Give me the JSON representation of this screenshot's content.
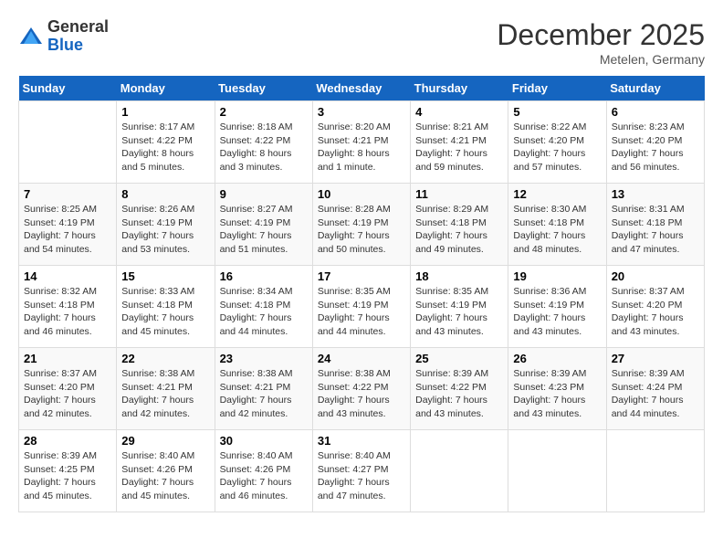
{
  "header": {
    "logo": {
      "general": "General",
      "blue": "Blue"
    },
    "title": "December 2025",
    "location": "Metelen, Germany"
  },
  "weekdays": [
    "Sunday",
    "Monday",
    "Tuesday",
    "Wednesday",
    "Thursday",
    "Friday",
    "Saturday"
  ],
  "weeks": [
    [
      {
        "day": "",
        "sunrise": "",
        "sunset": "",
        "daylight": ""
      },
      {
        "day": "1",
        "sunrise": "Sunrise: 8:17 AM",
        "sunset": "Sunset: 4:22 PM",
        "daylight": "Daylight: 8 hours and 5 minutes."
      },
      {
        "day": "2",
        "sunrise": "Sunrise: 8:18 AM",
        "sunset": "Sunset: 4:22 PM",
        "daylight": "Daylight: 8 hours and 3 minutes."
      },
      {
        "day": "3",
        "sunrise": "Sunrise: 8:20 AM",
        "sunset": "Sunset: 4:21 PM",
        "daylight": "Daylight: 8 hours and 1 minute."
      },
      {
        "day": "4",
        "sunrise": "Sunrise: 8:21 AM",
        "sunset": "Sunset: 4:21 PM",
        "daylight": "Daylight: 7 hours and 59 minutes."
      },
      {
        "day": "5",
        "sunrise": "Sunrise: 8:22 AM",
        "sunset": "Sunset: 4:20 PM",
        "daylight": "Daylight: 7 hours and 57 minutes."
      },
      {
        "day": "6",
        "sunrise": "Sunrise: 8:23 AM",
        "sunset": "Sunset: 4:20 PM",
        "daylight": "Daylight: 7 hours and 56 minutes."
      }
    ],
    [
      {
        "day": "7",
        "sunrise": "Sunrise: 8:25 AM",
        "sunset": "Sunset: 4:19 PM",
        "daylight": "Daylight: 7 hours and 54 minutes."
      },
      {
        "day": "8",
        "sunrise": "Sunrise: 8:26 AM",
        "sunset": "Sunset: 4:19 PM",
        "daylight": "Daylight: 7 hours and 53 minutes."
      },
      {
        "day": "9",
        "sunrise": "Sunrise: 8:27 AM",
        "sunset": "Sunset: 4:19 PM",
        "daylight": "Daylight: 7 hours and 51 minutes."
      },
      {
        "day": "10",
        "sunrise": "Sunrise: 8:28 AM",
        "sunset": "Sunset: 4:19 PM",
        "daylight": "Daylight: 7 hours and 50 minutes."
      },
      {
        "day": "11",
        "sunrise": "Sunrise: 8:29 AM",
        "sunset": "Sunset: 4:18 PM",
        "daylight": "Daylight: 7 hours and 49 minutes."
      },
      {
        "day": "12",
        "sunrise": "Sunrise: 8:30 AM",
        "sunset": "Sunset: 4:18 PM",
        "daylight": "Daylight: 7 hours and 48 minutes."
      },
      {
        "day": "13",
        "sunrise": "Sunrise: 8:31 AM",
        "sunset": "Sunset: 4:18 PM",
        "daylight": "Daylight: 7 hours and 47 minutes."
      }
    ],
    [
      {
        "day": "14",
        "sunrise": "Sunrise: 8:32 AM",
        "sunset": "Sunset: 4:18 PM",
        "daylight": "Daylight: 7 hours and 46 minutes."
      },
      {
        "day": "15",
        "sunrise": "Sunrise: 8:33 AM",
        "sunset": "Sunset: 4:18 PM",
        "daylight": "Daylight: 7 hours and 45 minutes."
      },
      {
        "day": "16",
        "sunrise": "Sunrise: 8:34 AM",
        "sunset": "Sunset: 4:18 PM",
        "daylight": "Daylight: 7 hours and 44 minutes."
      },
      {
        "day": "17",
        "sunrise": "Sunrise: 8:35 AM",
        "sunset": "Sunset: 4:19 PM",
        "daylight": "Daylight: 7 hours and 44 minutes."
      },
      {
        "day": "18",
        "sunrise": "Sunrise: 8:35 AM",
        "sunset": "Sunset: 4:19 PM",
        "daylight": "Daylight: 7 hours and 43 minutes."
      },
      {
        "day": "19",
        "sunrise": "Sunrise: 8:36 AM",
        "sunset": "Sunset: 4:19 PM",
        "daylight": "Daylight: 7 hours and 43 minutes."
      },
      {
        "day": "20",
        "sunrise": "Sunrise: 8:37 AM",
        "sunset": "Sunset: 4:20 PM",
        "daylight": "Daylight: 7 hours and 43 minutes."
      }
    ],
    [
      {
        "day": "21",
        "sunrise": "Sunrise: 8:37 AM",
        "sunset": "Sunset: 4:20 PM",
        "daylight": "Daylight: 7 hours and 42 minutes."
      },
      {
        "day": "22",
        "sunrise": "Sunrise: 8:38 AM",
        "sunset": "Sunset: 4:21 PM",
        "daylight": "Daylight: 7 hours and 42 minutes."
      },
      {
        "day": "23",
        "sunrise": "Sunrise: 8:38 AM",
        "sunset": "Sunset: 4:21 PM",
        "daylight": "Daylight: 7 hours and 42 minutes."
      },
      {
        "day": "24",
        "sunrise": "Sunrise: 8:38 AM",
        "sunset": "Sunset: 4:22 PM",
        "daylight": "Daylight: 7 hours and 43 minutes."
      },
      {
        "day": "25",
        "sunrise": "Sunrise: 8:39 AM",
        "sunset": "Sunset: 4:22 PM",
        "daylight": "Daylight: 7 hours and 43 minutes."
      },
      {
        "day": "26",
        "sunrise": "Sunrise: 8:39 AM",
        "sunset": "Sunset: 4:23 PM",
        "daylight": "Daylight: 7 hours and 43 minutes."
      },
      {
        "day": "27",
        "sunrise": "Sunrise: 8:39 AM",
        "sunset": "Sunset: 4:24 PM",
        "daylight": "Daylight: 7 hours and 44 minutes."
      }
    ],
    [
      {
        "day": "28",
        "sunrise": "Sunrise: 8:39 AM",
        "sunset": "Sunset: 4:25 PM",
        "daylight": "Daylight: 7 hours and 45 minutes."
      },
      {
        "day": "29",
        "sunrise": "Sunrise: 8:40 AM",
        "sunset": "Sunset: 4:26 PM",
        "daylight": "Daylight: 7 hours and 45 minutes."
      },
      {
        "day": "30",
        "sunrise": "Sunrise: 8:40 AM",
        "sunset": "Sunset: 4:26 PM",
        "daylight": "Daylight: 7 hours and 46 minutes."
      },
      {
        "day": "31",
        "sunrise": "Sunrise: 8:40 AM",
        "sunset": "Sunset: 4:27 PM",
        "daylight": "Daylight: 7 hours and 47 minutes."
      },
      {
        "day": "",
        "sunrise": "",
        "sunset": "",
        "daylight": ""
      },
      {
        "day": "",
        "sunrise": "",
        "sunset": "",
        "daylight": ""
      },
      {
        "day": "",
        "sunrise": "",
        "sunset": "",
        "daylight": ""
      }
    ]
  ]
}
